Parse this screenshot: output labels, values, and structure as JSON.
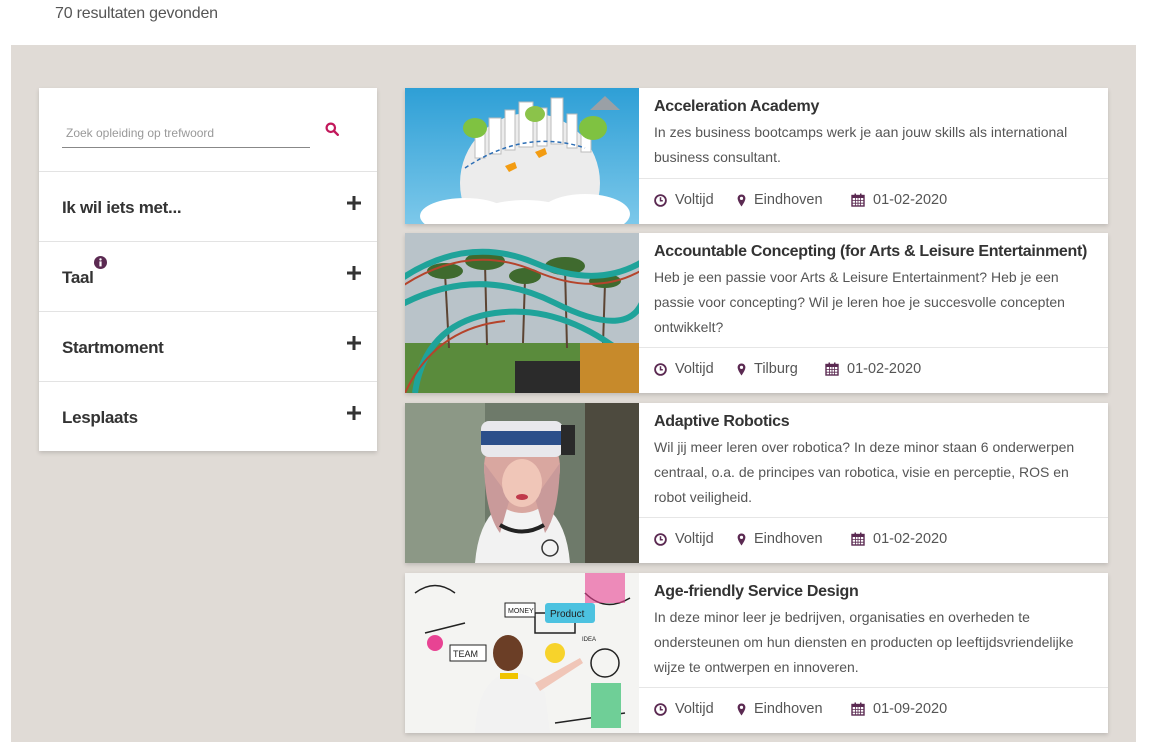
{
  "results": {
    "count_text": "70 resultaten gevonden"
  },
  "search": {
    "placeholder": "Zoek opleiding op trefwoord",
    "value": ""
  },
  "filters": [
    {
      "label": "Ik wil iets met..."
    },
    {
      "label": "Taal"
    },
    {
      "label": "Startmoment"
    },
    {
      "label": "Lesplaats"
    }
  ],
  "courses": [
    {
      "title": "Acceleration Academy",
      "description": "In zes business bootcamps werk je aan jouw skills als international business consultant.",
      "mode": "Voltijd",
      "location": "Eindhoven",
      "date": "01-02-2020",
      "image": "illustrated-city-globe-with-airplanes"
    },
    {
      "title": "Accountable Concepting (for Arts & Leisure Entertainment)",
      "description": "Heb je een passie voor Arts & Leisure Entertainment? Heb je een passie voor concepting? Wil je leren hoe je succesvolle concepten ontwikkelt?",
      "mode": "Voltijd",
      "location": "Tilburg",
      "date": "01-02-2020",
      "image": "rollercoaster-and-palm-trees"
    },
    {
      "title": "Adaptive Robotics",
      "description": "Wil jij meer leren over robotica? In deze minor staan 6 onderwerpen centraal, o.a. de principes van robotica, visie en perceptie, ROS en robot veiligheid.",
      "mode": "Voltijd",
      "location": "Eindhoven",
      "date": "01-02-2020",
      "image": "woman-wearing-vr-headset"
    },
    {
      "title": "Age-friendly Service Design",
      "description": "In deze minor leer je bedrijven, organisaties en overheden te ondersteunen om hun diensten en producten op leeftijdsvriendelijke wijze te ontwerpen en innoveren.",
      "mode": "Voltijd",
      "location": "Eindhoven",
      "date": "01-09-2020",
      "image": "woman-drawing-doodles-on-wall",
      "doodle_words": [
        "MONEY",
        "Product",
        "TEAM",
        "IDEA"
      ]
    }
  ],
  "colors": {
    "accent": "#c2185b",
    "icon": "#5b2a52",
    "background": "#e0dbd6"
  }
}
